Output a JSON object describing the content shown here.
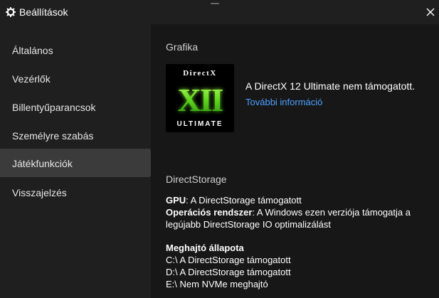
{
  "window": {
    "title": "Beállítások",
    "settings_icon": "gear-icon",
    "close_icon": "close-icon"
  },
  "sidebar": {
    "items": [
      {
        "label": "Általános",
        "active": false
      },
      {
        "label": "Vezérlők",
        "active": false
      },
      {
        "label": "Billentyűparancsok",
        "active": false
      },
      {
        "label": "Személyre szabás",
        "active": false
      },
      {
        "label": "Játékfunkciók",
        "active": true
      },
      {
        "label": "Visszajelzés",
        "active": false
      }
    ]
  },
  "graphics": {
    "heading": "Grafika",
    "logo": {
      "top_text": "DirectX",
      "numeral": "XII",
      "bottom_text": "ULTIMATE"
    },
    "status": "A DirectX 12 Ultimate nem támogatott.",
    "link": "További információ"
  },
  "directstorage": {
    "heading": "DirectStorage",
    "gpu_label": "GPU",
    "gpu_value": ": A DirectStorage támogatott",
    "os_label": "Operációs rendszer",
    "os_value": ": A Windows ezen verziója támogatja a legújabb DirectStorage IO optimalizálást",
    "drive_heading": "Meghajtó állapota",
    "drives": [
      "C:\\ A DirectStorage támogatott",
      "D:\\ A DirectStorage támogatott",
      "E:\\ Nem NVMe meghajtó"
    ]
  },
  "colors": {
    "background": "#1f1f1f",
    "content_background": "#171717",
    "active_item": "#3b3b3b",
    "link": "#4ea1ff",
    "logo_green": "#5fd61f"
  }
}
